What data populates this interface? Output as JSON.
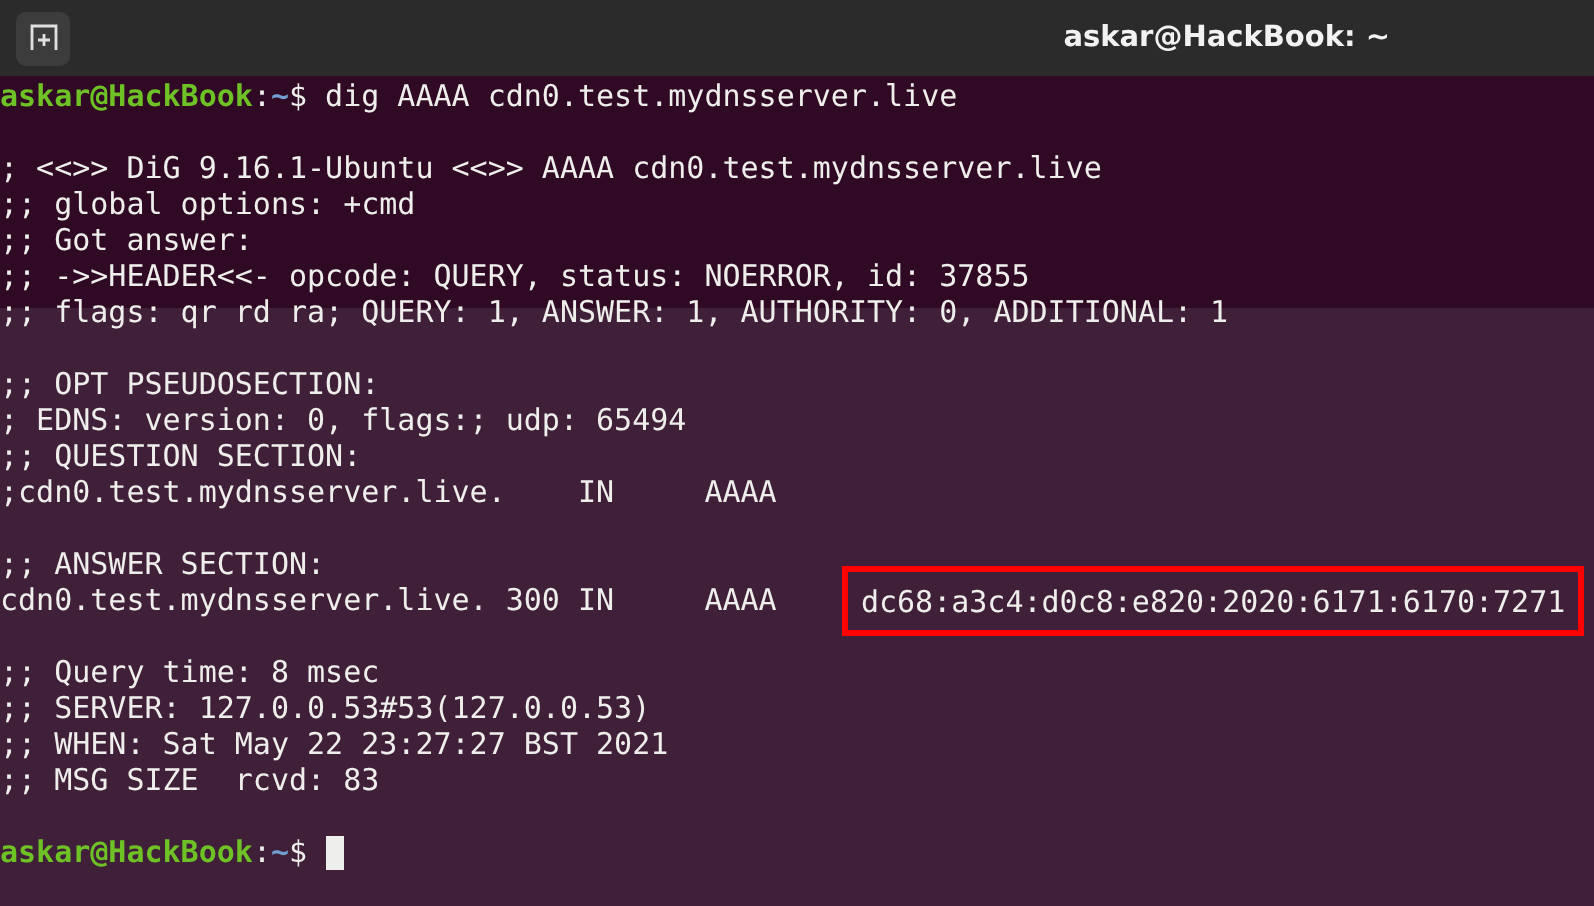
{
  "window": {
    "title": "askar@HackBook: ~"
  },
  "lines": [
    {
      "kind": "prompt",
      "user_host": "askar@HackBook",
      "separator": ":",
      "path": "~",
      "symbol": "$",
      "command": " dig AAAA cdn0.test.mydnsserver.live",
      "cursor": false
    },
    {
      "kind": "blank"
    },
    {
      "kind": "output",
      "text": "; <<>> DiG 9.16.1-Ubuntu <<>> AAAA cdn0.test.mydnsserver.live"
    },
    {
      "kind": "output",
      "text": ";; global options: +cmd"
    },
    {
      "kind": "output",
      "text": ";; Got answer:"
    },
    {
      "kind": "output",
      "text": ";; ->>HEADER<<- opcode: QUERY, status: NOERROR, id: 37855"
    },
    {
      "kind": "output",
      "text": ";; flags: qr rd ra; QUERY: 1, ANSWER: 1, AUTHORITY: 0, ADDITIONAL: 1"
    },
    {
      "kind": "blank"
    },
    {
      "kind": "output",
      "text": ";; OPT PSEUDOSECTION:"
    },
    {
      "kind": "output",
      "text": "; EDNS: version: 0, flags:; udp: 65494"
    },
    {
      "kind": "output",
      "text": ";; QUESTION SECTION:"
    },
    {
      "kind": "output",
      "text": ";cdn0.test.mydnsserver.live.    IN     AAAA"
    },
    {
      "kind": "blank"
    },
    {
      "kind": "output",
      "text": ";; ANSWER SECTION:"
    },
    {
      "kind": "record",
      "text": "cdn0.test.mydnsserver.live. 300 IN     AAAA    ",
      "highlight": "dc68:a3c4:d0c8:e820:2020:6171:6170:7271"
    },
    {
      "kind": "blank"
    },
    {
      "kind": "output",
      "text": ";; Query time: 8 msec"
    },
    {
      "kind": "output",
      "text": ";; SERVER: 127.0.0.53#53(127.0.0.53)"
    },
    {
      "kind": "output",
      "text": ";; WHEN: Sat May 22 23:27:27 BST 2021"
    },
    {
      "kind": "output",
      "text": ";; MSG SIZE  rcvd: 83"
    },
    {
      "kind": "blank"
    },
    {
      "kind": "prompt",
      "user_host": "askar@HackBook",
      "separator": ":",
      "path": "~",
      "symbol": "$",
      "cursor": true
    }
  ]
}
